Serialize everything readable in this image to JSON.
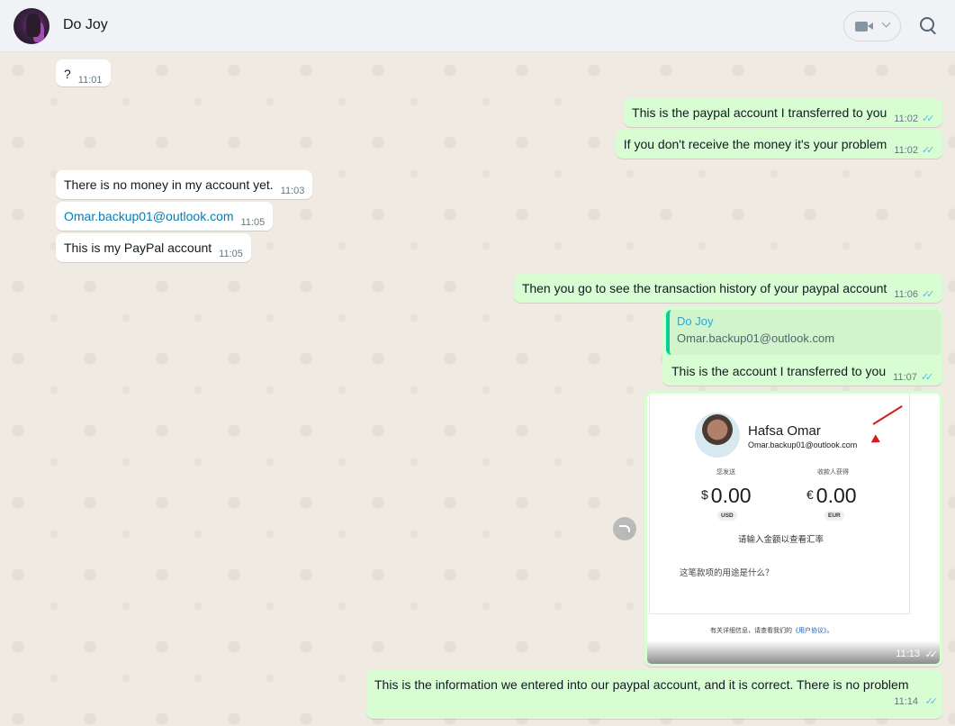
{
  "header": {
    "contact_name": "Do Joy"
  },
  "messages": {
    "m0": {
      "text": "?",
      "time": "11:01"
    },
    "m1": {
      "text": "This is the paypal account I transferred to you",
      "time": "11:02"
    },
    "m2": {
      "text": "If you don't receive the money it's your problem",
      "time": "11:02"
    },
    "m3": {
      "text": "There is no money in my account yet.",
      "time": "11:03"
    },
    "m4": {
      "text": "Omar.backup01@outlook.com",
      "time": "11:05"
    },
    "m5": {
      "text": "This is my PayPal account",
      "time": "11:05"
    },
    "m6": {
      "text": "Then you go to see the transaction history of your paypal account",
      "time": "11:06"
    },
    "m7": {
      "quote_author": "Do Joy",
      "quote_text": "Omar.backup01@outlook.com",
      "text": "This is the account I transferred to you",
      "time": "11:07"
    },
    "m8": {
      "time": "11:13",
      "screenshot": {
        "name": "Hafsa Omar",
        "email": "Omar.backup01@outlook.com",
        "send_label": "您发送",
        "receive_label": "收款人获得",
        "send_currency_symbol": "$",
        "send_amount": "0.00",
        "send_currency": "USD",
        "receive_currency_symbol": "€",
        "receive_amount": "0.00",
        "receive_currency": "EUR",
        "hint": "请输入金额以查看汇率",
        "note_placeholder": "这笔款项的用途是什么？",
        "footer_prefix": "有关详细信息，请查看我们的",
        "footer_link": "《用户协议》",
        "footer_suffix": "。"
      }
    },
    "m9": {
      "text": "This is the information we entered into our paypal account, and it is correct. There is no problem",
      "time": "11:14"
    }
  },
  "colors": {
    "incoming_bubble": "#ffffff",
    "outgoing_bubble": "#d9fdd3",
    "read_ticks": "#53bdeb",
    "link": "#027eb5",
    "header_bg": "#f0f2f5"
  },
  "icons": {
    "video": "video-camera-icon",
    "dropdown": "chevron-down-icon",
    "search": "search-icon",
    "forward": "forward-icon",
    "ticks": "double-check-icon"
  }
}
